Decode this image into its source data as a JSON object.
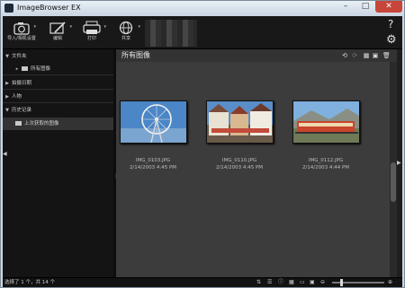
{
  "window": {
    "title": "ImageBrowser EX",
    "minimize": "–",
    "maximize": "□",
    "close": "✕"
  },
  "toolbar": {
    "buttons": [
      {
        "label": "导入/相机设置",
        "icon": "camera-icon"
      },
      {
        "label": "编辑",
        "icon": "edit-icon"
      },
      {
        "label": "打印",
        "icon": "printer-icon"
      },
      {
        "label": "共享",
        "icon": "globe-icon"
      }
    ],
    "help": "?",
    "settings": "⚙"
  },
  "sidebar": {
    "folders": "文件夹",
    "all_images": "所有图像",
    "shooting_date": "拍摄日期",
    "people": "人物",
    "history": "历史记录",
    "last_acquired": "上次获取的图像"
  },
  "main": {
    "title": "所有图像",
    "images": [
      {
        "filename": "IMG_0103.JPG",
        "datetime": "2/14/2003 4:45 PM"
      },
      {
        "filename": "IMG_0110.JPG",
        "datetime": "2/14/2003 4:45 PM"
      },
      {
        "filename": "IMG_0112.JPG",
        "datetime": "2/14/2003 4:44 PM"
      }
    ]
  },
  "status": {
    "text": "选择了 1 个，共 14 个"
  }
}
